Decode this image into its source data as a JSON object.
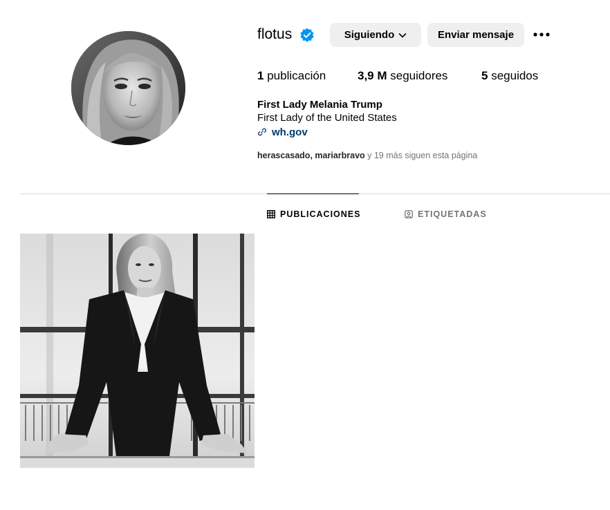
{
  "profile": {
    "username": "flotus",
    "following_label": "Siguiendo",
    "message_label": "Enviar mensaje",
    "stats": {
      "posts_count": "1",
      "posts_label": "publicación",
      "followers_count": "3,9 M",
      "followers_label": "seguidores",
      "following_count": "5",
      "following_label": "seguidos"
    },
    "full_name": "First Lady Melania Trump",
    "bio": "First Lady of the United States",
    "link": "wh.gov",
    "followed_by": {
      "user1": "herascasado",
      "separator": ", ",
      "user2": "mariarbravo",
      "rest": " y 19 más siguen esta página"
    }
  },
  "tabs": {
    "posts": "PUBLICACIONES",
    "tagged": "ETIQUETADAS"
  },
  "colors": {
    "verified_blue": "#0095f6",
    "button_bg": "#efefef",
    "link": "#00376b",
    "muted": "#737373",
    "divider": "#dbdbdb"
  }
}
